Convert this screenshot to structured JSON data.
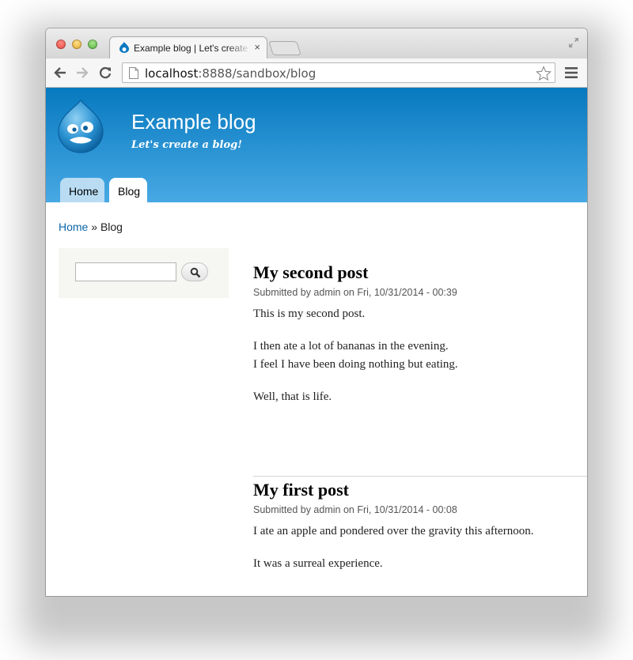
{
  "browser": {
    "tab": {
      "title": "Example blog | Let's create a blog!",
      "close": "×"
    },
    "address": {
      "host": "localhost",
      "path": ":8888/sandbox/blog"
    }
  },
  "site": {
    "name": "Example blog",
    "slogan": "Let's create a blog!",
    "nav": [
      {
        "label": "Home"
      },
      {
        "label": "Blog"
      }
    ],
    "accent": "#0779bf"
  },
  "breadcrumb": {
    "home": "Home",
    "sep": " » ",
    "current": "Blog"
  },
  "search": {
    "value": ""
  },
  "posts": [
    {
      "title": "My second post",
      "submitted": "Submitted by admin on Fri, 10/31/2014 - 00:39",
      "paragraphs": [
        "This is my second post.",
        "I then ate a lot of bananas in the evening.",
        "I feel I have been doing nothing but eating.",
        "Well, that is life."
      ]
    },
    {
      "title": "My first post",
      "submitted": "Submitted by admin on Fri, 10/31/2014 - 00:08",
      "paragraphs": [
        "I ate an apple and pondered over the gravity this afternoon.",
        "It was a surreal experience."
      ]
    }
  ]
}
